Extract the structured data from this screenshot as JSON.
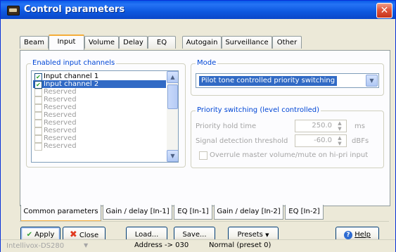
{
  "window": {
    "title": "Control parameters"
  },
  "tabs": [
    "Beam",
    "Input",
    "Volume",
    "Delay",
    "EQ",
    "Autogain",
    "Surveillance",
    "Other"
  ],
  "enabled_channels": {
    "legend": "Enabled input channels",
    "items": [
      {
        "label": "Input channel 1",
        "checked": true
      },
      {
        "label": "Input channel 2",
        "checked": true
      },
      {
        "label": "Reserved",
        "checked": false
      },
      {
        "label": "Reserved",
        "checked": false
      },
      {
        "label": "Reserved",
        "checked": false
      },
      {
        "label": "Reserved",
        "checked": false
      },
      {
        "label": "Reserved",
        "checked": false
      },
      {
        "label": "Reserved",
        "checked": false
      },
      {
        "label": "Reserved",
        "checked": false
      },
      {
        "label": "Reserved",
        "checked": false
      }
    ]
  },
  "mode": {
    "legend": "Mode",
    "value": "Pilot tone controlled priority switching"
  },
  "priority": {
    "legend": "Priority switching (level controlled)",
    "hold_label": "Priority hold time",
    "hold_value": "250.0",
    "hold_unit": "ms",
    "threshold_label": "Signal detection threshold",
    "threshold_value": "-60.0",
    "threshold_unit": "dBFs",
    "overrule_label": "Overrule master volume/mute on hi-pri input"
  },
  "subtabs": [
    "Common parameters",
    "Gain / delay [In-1]",
    "EQ [In-1]",
    "Gain / delay [In-2]",
    "EQ [In-2]"
  ],
  "buttons": {
    "apply": "Apply",
    "close": "Close",
    "load": "Load...",
    "save": "Save...",
    "presets": "Presets",
    "help": "Help"
  },
  "status": {
    "device": "Intellivox-DS280",
    "address": "Address -> 030",
    "state": "Normal (preset 0)"
  },
  "colors": {
    "title_bar": "#0a5be8",
    "selection": "#316ac5",
    "legend": "#0046d5",
    "tab_highlight": "#f5ad3a"
  },
  "icons": {
    "title": "speaker-icon",
    "close": "close-icon",
    "apply": "checkmark-icon",
    "close_btn": "red-x-icon",
    "help": "help-icon"
  }
}
